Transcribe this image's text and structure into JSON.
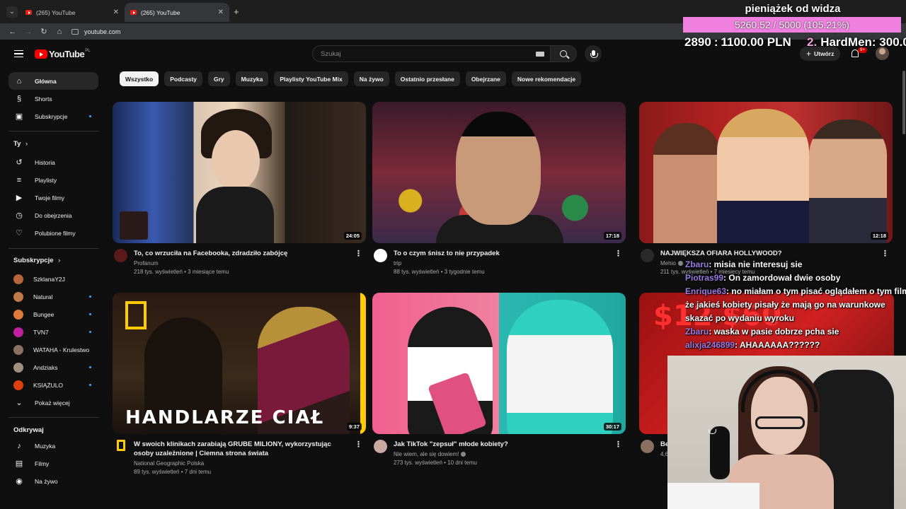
{
  "browser": {
    "tabs": [
      {
        "label": "(265) YouTube",
        "close": "✕"
      },
      {
        "label": "(265) YouTube",
        "close": "✕"
      }
    ],
    "new_tab": "+",
    "url": "youtube.com"
  },
  "header": {
    "logo_text": "YouTube",
    "country": "PL",
    "search_placeholder": "Szukaj",
    "create_label": "Utwórz",
    "notif_badge": "9+"
  },
  "sidebar": {
    "main": [
      {
        "label": "Główna",
        "icon": "home-icon",
        "active": true
      },
      {
        "label": "Shorts",
        "icon": "shorts-icon"
      },
      {
        "label": "Subskrypcje",
        "icon": "subscriptions-icon",
        "dot": true
      }
    ],
    "you_title": "Ty",
    "you": [
      {
        "label": "Historia",
        "icon": "history-icon"
      },
      {
        "label": "Playlisty",
        "icon": "playlist-icon"
      },
      {
        "label": "Twoje filmy",
        "icon": "your-videos-icon"
      },
      {
        "label": "Do obejrzenia",
        "icon": "watch-later-icon"
      },
      {
        "label": "Polubione filmy",
        "icon": "like-icon"
      }
    ],
    "subs_title": "Subskrypcje",
    "subs": [
      {
        "label": "SzklanaY2J",
        "color": "#b8643a"
      },
      {
        "label": "Natural",
        "color": "#c07a4a",
        "dot": true
      },
      {
        "label": "Bungee",
        "color": "#e07a3a",
        "dot": true
      },
      {
        "label": "TVN7",
        "color": "#c020a0",
        "dot": true
      },
      {
        "label": "WATAHA - Krulestwo",
        "color": "#8a7060"
      },
      {
        "label": "Andziaks",
        "color": "#a09080",
        "dot": true
      },
      {
        "label": "KSIĄŻULO",
        "color": "#e04010",
        "dot": true
      }
    ],
    "show_more": "Pokaż więcej",
    "explore_title": "Odkrywaj",
    "explore": [
      {
        "label": "Muzyka",
        "icon": "music-icon"
      },
      {
        "label": "Filmy",
        "icon": "film-icon"
      },
      {
        "label": "Na żywo",
        "icon": "live-icon"
      }
    ]
  },
  "chips": [
    "Wszystko",
    "Podcasty",
    "Gry",
    "Muzyka",
    "Playlisty YouTube Mix",
    "Na żywo",
    "Ostatnio przesłane",
    "Obejrzane",
    "Nowe rekomendacje"
  ],
  "videos": [
    {
      "title": "To, co wrzuciła na Facebooka, zdradziło zabójcę",
      "channel": "Profanum",
      "stats": "218 tys. wyświetleń • 3 miesiące temu",
      "duration": "24:05",
      "avatar_color": "#5a1a1a"
    },
    {
      "title": "To o czym śnisz to nie przypadek",
      "channel": "trip",
      "stats": "88 tys. wyświetleń • 3 tygodnie temu",
      "duration": "17:18",
      "avatar_color": "#ffffff"
    },
    {
      "title": "NAJWIĘKSZA OFIARA HOLLYWOOD?",
      "channel": "Mehio",
      "stats": "211 tys. wyświetleń • 7 miesięcy temu",
      "duration": "12:18",
      "avatar_color": "#2a2a2a"
    },
    {
      "title": "W swoich klinikach zarabiają GRUBE MILIONY, wykorzystując osoby uzależnione | Ciemna strona świata",
      "channel": "National Geographic Polska",
      "stats": "89 tys. wyświetleń • 7 dni temu",
      "duration": "9:37",
      "avatar_color": "#ffcc00",
      "thumb_text": "HANDLARZE CIAŁ"
    },
    {
      "title": "Jak TikTok \"zepsuł\" młode kobiety?",
      "channel": "Nie wiem, ale się dowiem!",
      "stats": "273 tys. wyświetleń • 10 dni temu",
      "duration": "30:17",
      "avatar_color": "#c8a8a0"
    },
    {
      "title": "Be",
      "channel": "",
      "stats": "4,6",
      "duration": "",
      "avatar_color": "#8a7060",
      "thumb_text": "$12 $60"
    }
  ],
  "overlay": {
    "donate_title": "pieniążek od widza",
    "donate_progress_text": "5260.52 / 5000 (105.21%)",
    "donate_fraction": 1.0,
    "top1_rank": "2890",
    "top1_amount": "1100.00 PLN",
    "top2_rank": "2.",
    "top2_amount": "HardMen: 300.0",
    "chat": [
      {
        "user": "Zbaru",
        "text": ": misia nie interesuj sie"
      },
      {
        "user": "Piotras99",
        "text": ": On zamordował dwie osoby"
      },
      {
        "user": "Enrique63",
        "text": ": no miałam o tym pisać oglądałem o tym film"
      },
      {
        "user": "",
        "text": "że jakieś kobiety pisały że mają go na warunkowe"
      },
      {
        "user": "",
        "text": "skazać po wydaniu wyroku"
      },
      {
        "user": "Zbaru",
        "text": ": waska w pasie dobrze pcha sie"
      },
      {
        "user": "alixja246899",
        "text": ": AHAAAAAA??????"
      }
    ]
  }
}
